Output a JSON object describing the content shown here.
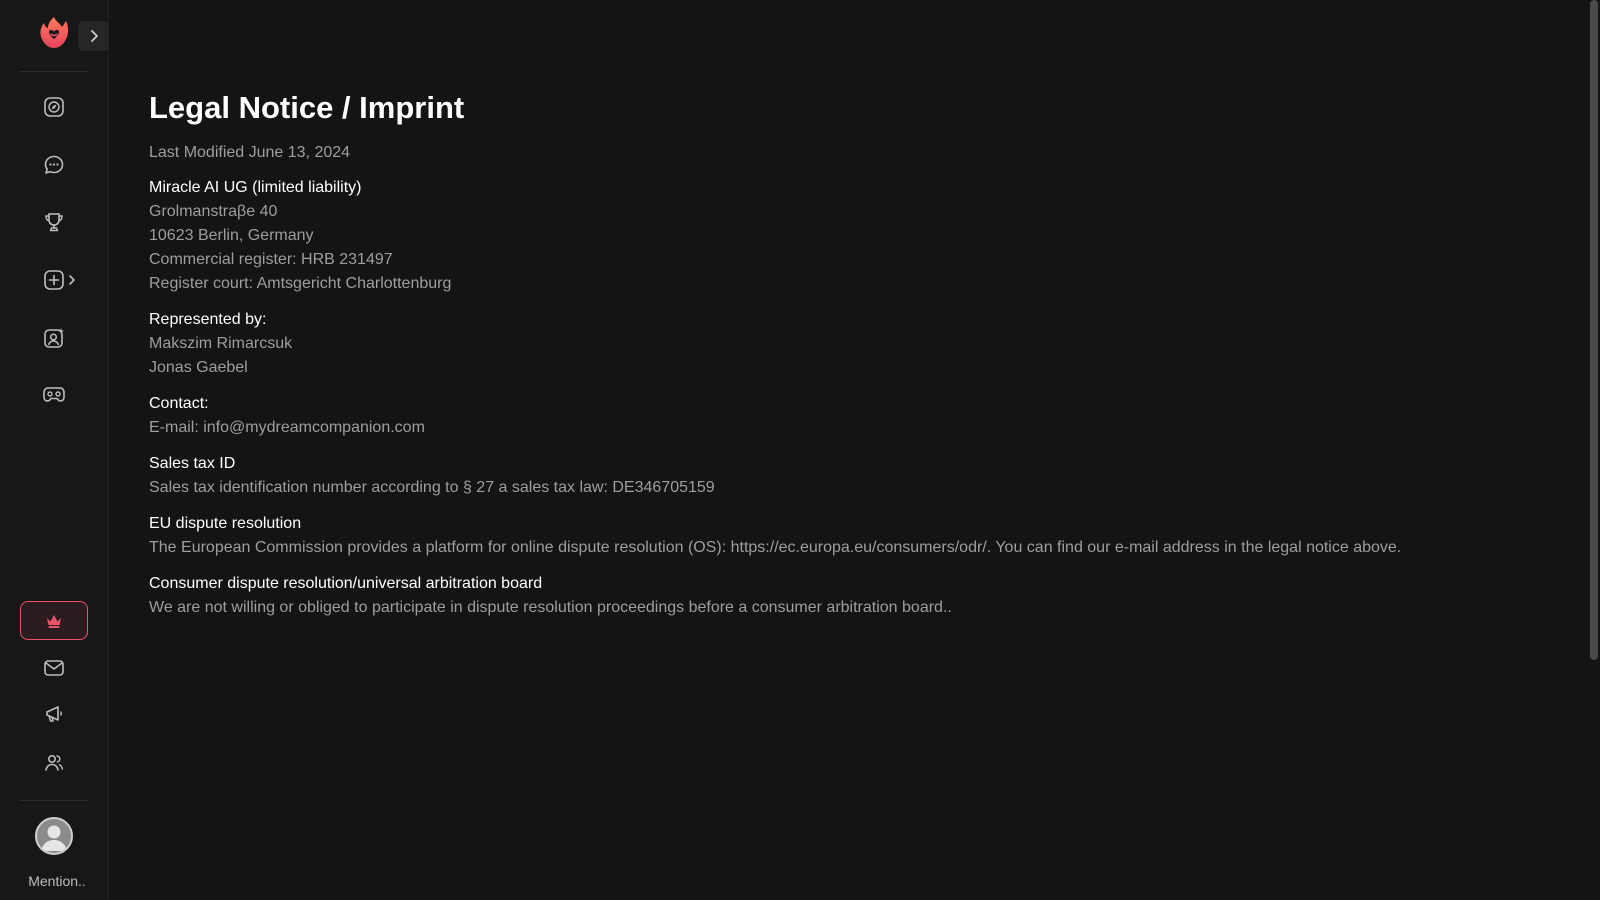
{
  "sidebar": {
    "logo": "flame-heart-logo",
    "expand_icon": "chevron-right-icon",
    "nav_items": [
      {
        "icon": "compass-icon",
        "name": "explore"
      },
      {
        "icon": "chat-icon",
        "name": "chat"
      },
      {
        "icon": "trophy-icon",
        "name": "leaderboard"
      },
      {
        "icon": "plus-square-icon",
        "name": "create"
      },
      {
        "icon": "user-sparkle-icon",
        "name": "my-companions"
      },
      {
        "icon": "gamepad-icon",
        "name": "games"
      }
    ],
    "bottom_items": [
      {
        "icon": "crown-icon",
        "name": "premium"
      },
      {
        "icon": "mail-icon",
        "name": "messages"
      },
      {
        "icon": "megaphone-icon",
        "name": "announcements"
      },
      {
        "icon": "users-icon",
        "name": "affiliate"
      }
    ],
    "username": "Mention.."
  },
  "page": {
    "title": "Legal Notice / Imprint",
    "last_modified": "Last Modified June 13, 2024",
    "sections": [
      {
        "heading": "Miracle AI UG (limited liability)",
        "lines": [
          "Grolmanstraβe 40",
          "10623 Berlin, Germany",
          "Commercial register: HRB 231497",
          "Register court: Amtsgericht Charlottenburg"
        ]
      },
      {
        "heading": "Represented by:",
        "lines": [
          "Makszim Rimarcsuk",
          "Jonas Gaebel"
        ]
      },
      {
        "heading": "Contact:",
        "lines": [
          "E-mail: info@mydreamcompanion.com"
        ]
      },
      {
        "heading": "Sales tax ID",
        "lines": [
          "Sales tax identification number according to § 27 a sales tax law: DE346705159"
        ]
      },
      {
        "heading": "EU dispute resolution",
        "lines": [
          "The European Commission provides a platform for online dispute resolution (OS): https://ec.europa.eu/consumers/odr/. You can find our e-mail address in the legal notice above."
        ]
      },
      {
        "heading": "Consumer dispute resolution/universal arbitration board",
        "lines": [
          "We are not willing or obliged to participate in dispute resolution proceedings before a consumer arbitration board.."
        ]
      }
    ]
  },
  "colors": {
    "background": "#141414",
    "sidebar": "#171717",
    "accent": "#e8556a",
    "text_primary": "#ffffff",
    "text_secondary": "#9e9e9e"
  }
}
